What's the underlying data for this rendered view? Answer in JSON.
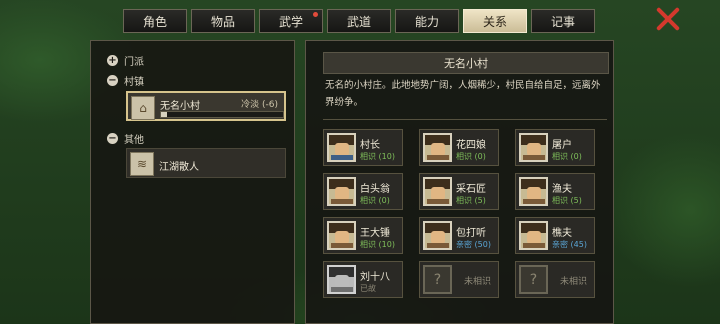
{
  "tabs": [
    {
      "label": "角色",
      "active": false,
      "badge": false
    },
    {
      "label": "物品",
      "active": false,
      "badge": false
    },
    {
      "label": "武学",
      "active": false,
      "badge": true
    },
    {
      "label": "武道",
      "active": false,
      "badge": false
    },
    {
      "label": "能力",
      "active": false,
      "badge": false
    },
    {
      "label": "关系",
      "active": true,
      "badge": false
    },
    {
      "label": "记事",
      "active": false,
      "badge": false
    }
  ],
  "close_icon": "close-x-icon",
  "sidebar": {
    "groups": [
      {
        "label": "门派",
        "sign": "+"
      },
      {
        "label": "村镇",
        "sign": "−"
      },
      {
        "label": "其他",
        "sign": "−"
      }
    ],
    "entries": [
      {
        "name": "无名小村",
        "value": "冷淡 (-6)",
        "progress": 0.05,
        "selected": true,
        "icon": "hut-icon"
      },
      {
        "name": "江湖散人",
        "value": "",
        "progress": null,
        "selected": false,
        "icon": "scroll-icon"
      }
    ]
  },
  "detail": {
    "title": "无名小村",
    "description": "无名的小村庄。此地地势广阔，人烟稀少，村民自给自足，远离外界纷争。",
    "people": [
      {
        "name": "村长",
        "status": "相识 (10)",
        "tone": "green",
        "outfit": "blue"
      },
      {
        "name": "花四娘",
        "status": "相识 (0)",
        "tone": "green",
        "outfit": "brown"
      },
      {
        "name": "屠户",
        "status": "相识 (0)",
        "tone": "green",
        "outfit": "brown"
      },
      {
        "name": "白头翁",
        "status": "相识 (0)",
        "tone": "green",
        "outfit": "brown"
      },
      {
        "name": "采石匠",
        "status": "相识 (5)",
        "tone": "green",
        "outfit": "brown"
      },
      {
        "name": "渔夫",
        "status": "相识 (5)",
        "tone": "green",
        "outfit": "brown"
      },
      {
        "name": "王大锤",
        "status": "相识 (10)",
        "tone": "green",
        "outfit": "brown"
      },
      {
        "name": "包打听",
        "status": "亲密 (50)",
        "tone": "blue",
        "outfit": "brown"
      },
      {
        "name": "樵夫",
        "status": "亲密 (45)",
        "tone": "blue",
        "outfit": "brown"
      },
      {
        "name": "刘十八",
        "status": "已故",
        "tone": "grey",
        "outfit": "grey"
      },
      {
        "name": "",
        "status": "未相识",
        "tone": "locked",
        "outfit": ""
      },
      {
        "name": "",
        "status": "未相识",
        "tone": "locked",
        "outfit": ""
      }
    ]
  },
  "colors": {
    "accent": "#d6c48d",
    "friendly": "#7fbf5a",
    "intimate": "#5aa6d6",
    "close": "#d4392d"
  }
}
